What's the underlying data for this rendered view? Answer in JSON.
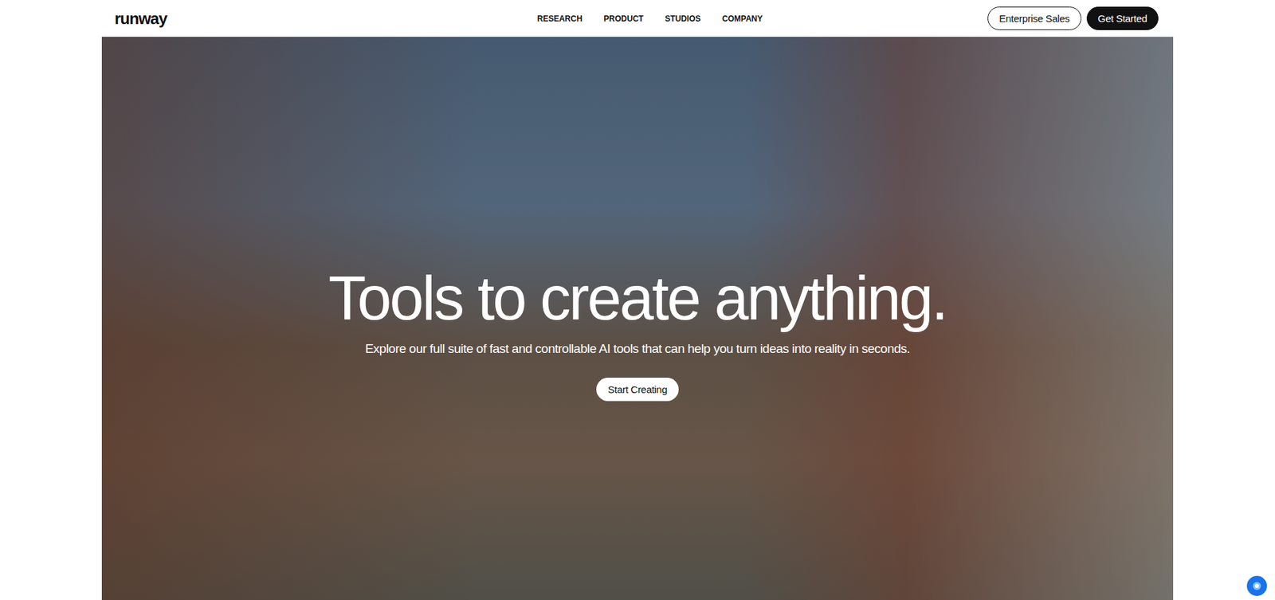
{
  "nav": {
    "logo": "runway",
    "links": [
      {
        "label": "RESEARCH"
      },
      {
        "label": "PRODUCT"
      },
      {
        "label": "STUDIOS"
      },
      {
        "label": "COMPANY"
      }
    ],
    "buttons": [
      {
        "label": "Enterprise Sales",
        "kind": "outline"
      },
      {
        "label": "Get Started",
        "kind": "filled"
      }
    ]
  },
  "hero": {
    "title": "Tools to create anything.",
    "subtitle": "Explore our full suite of fast and controllable AI tools that can help you turn ideas into reality in seconds.",
    "button": "Start Creating"
  }
}
